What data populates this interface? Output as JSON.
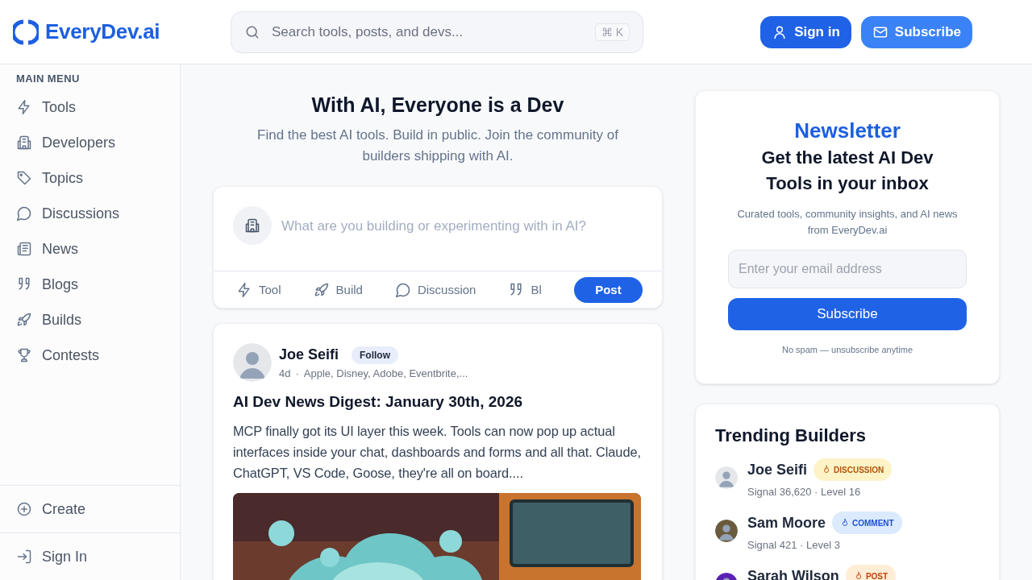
{
  "header": {
    "logo": "EveryDev.ai",
    "search": {
      "placeholder": "Search tools, posts, and devs...",
      "shortcut": "⌘ K"
    },
    "buttons": [
      {
        "label": "Sign in",
        "kind": "primary"
      },
      {
        "label": "Subscribe",
        "kind": "secondary"
      }
    ]
  },
  "sidebar": {
    "heading": "MAIN MENU",
    "items": [
      "Tools",
      "Developers",
      "Topics",
      "Discussions",
      "News",
      "Blogs",
      "Builds",
      "Contests"
    ],
    "footer": [
      "Create",
      "Sign In"
    ]
  },
  "hero": {
    "title": "With AI, Everyone is a Dev",
    "subtitle": "Find the best AI tools. Build in public. Join the community of builders shipping with AI."
  },
  "composer": {
    "placeholder": "What are you building or experimenting with in AI?",
    "actions": [
      "Tool",
      "Build",
      "Discussion",
      "Bl"
    ],
    "submit": "Post"
  },
  "post": {
    "author": "Joe Seifi",
    "follow": "Follow",
    "time": "4d",
    "separator": "·",
    "companies": "Apple, Disney, Adobe, Eventbrite,...",
    "title": "AI Dev News Digest: January 30th, 2026",
    "body": "MCP finally got its UI layer this week. Tools can now pop up actual interfaces inside your chat, dashboards and forms and all that. Claude, ChatGPT, VS Code, Goose, they're all on board...."
  },
  "newsletter": {
    "brand": "Newsletter",
    "title": "Get the latest AI Dev Tools in your inbox",
    "description": "Curated tools, community insights, and AI news from EveryDev.ai",
    "email_placeholder": "Enter your email address",
    "button": "Subscribe",
    "note": "No spam — unsubscribe anytime"
  },
  "trending": {
    "title": "Trending Builders",
    "builders": [
      {
        "name": "Joe Seifi",
        "badge": "DISCUSSION",
        "kind": "discussion",
        "stats": "Signal 36,620 · Level 16"
      },
      {
        "name": "Sam Moore",
        "badge": "COMMENT",
        "kind": "comment",
        "stats": "Signal 421 · Level 3"
      },
      {
        "name": "Sarah Wilson",
        "badge": "POST",
        "kind": "post"
      }
    ]
  }
}
